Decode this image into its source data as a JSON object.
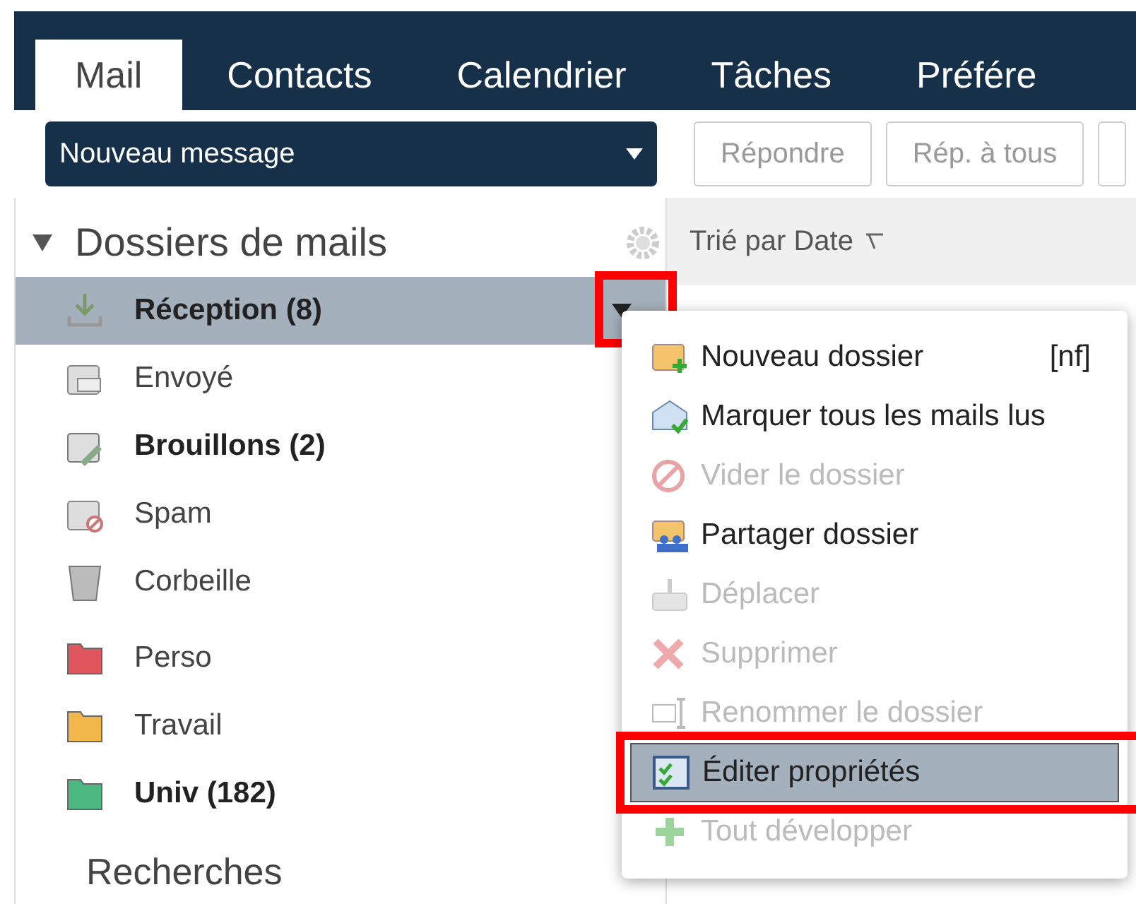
{
  "tabs": [
    {
      "label": "Mail",
      "selected": true
    },
    {
      "label": "Contacts",
      "selected": false
    },
    {
      "label": "Calendrier",
      "selected": false
    },
    {
      "label": "Tâches",
      "selected": false
    },
    {
      "label": "Préfére",
      "selected": false
    }
  ],
  "toolbar": {
    "new_message": "Nouveau message",
    "buttons": [
      "Répondre",
      "Rép. à tous"
    ]
  },
  "folders_header": "Dossiers de mails",
  "folders": [
    {
      "label": "Réception (8)",
      "kind": "inbox",
      "unread": true,
      "selected": true,
      "annotated": true
    },
    {
      "label": "Envoyé",
      "kind": "sent",
      "unread": false,
      "selected": false,
      "annotated": false
    },
    {
      "label": "Brouillons (2)",
      "kind": "drafts",
      "unread": true,
      "selected": false,
      "annotated": false
    },
    {
      "label": "Spam",
      "kind": "spam",
      "unread": false,
      "selected": false,
      "annotated": false
    },
    {
      "label": "Corbeille",
      "kind": "trash",
      "unread": false,
      "selected": false,
      "annotated": false
    },
    {
      "label": "Perso",
      "kind": "folder",
      "color": "#e0555e",
      "unread": false,
      "selected": false,
      "annotated": false
    },
    {
      "label": "Travail",
      "kind": "folder",
      "color": "#f2b84b",
      "unread": false,
      "selected": false,
      "annotated": false
    },
    {
      "label": "Univ (182)",
      "kind": "folder",
      "color": "#4cb882",
      "unread": true,
      "selected": false,
      "annotated": false
    }
  ],
  "searches_header": "Recherches",
  "list_header": "Trié par Date",
  "context_menu": [
    {
      "label": "Nouveau dossier",
      "shortcut": "[nf]",
      "kind": "new-folder",
      "disabled": false,
      "selected": false,
      "annotated": false
    },
    {
      "label": "Marquer tous les mails lus",
      "kind": "mark-read",
      "disabled": false,
      "selected": false,
      "annotated": false
    },
    {
      "label": "Vider le dossier",
      "kind": "empty",
      "disabled": true,
      "selected": false,
      "annotated": false
    },
    {
      "label": "Partager dossier",
      "kind": "share",
      "disabled": false,
      "selected": false,
      "annotated": false
    },
    {
      "label": "Déplacer",
      "kind": "move",
      "disabled": true,
      "selected": false,
      "annotated": false
    },
    {
      "label": "Supprimer",
      "kind": "delete",
      "disabled": true,
      "selected": false,
      "annotated": false
    },
    {
      "label": "Renommer le dossier",
      "kind": "rename",
      "disabled": true,
      "selected": false,
      "annotated": false
    },
    {
      "label": "Éditer propriétés",
      "kind": "properties",
      "disabled": false,
      "selected": true,
      "annotated": true
    },
    {
      "label": "Tout développer",
      "kind": "expand",
      "disabled": true,
      "selected": false,
      "annotated": false
    }
  ]
}
